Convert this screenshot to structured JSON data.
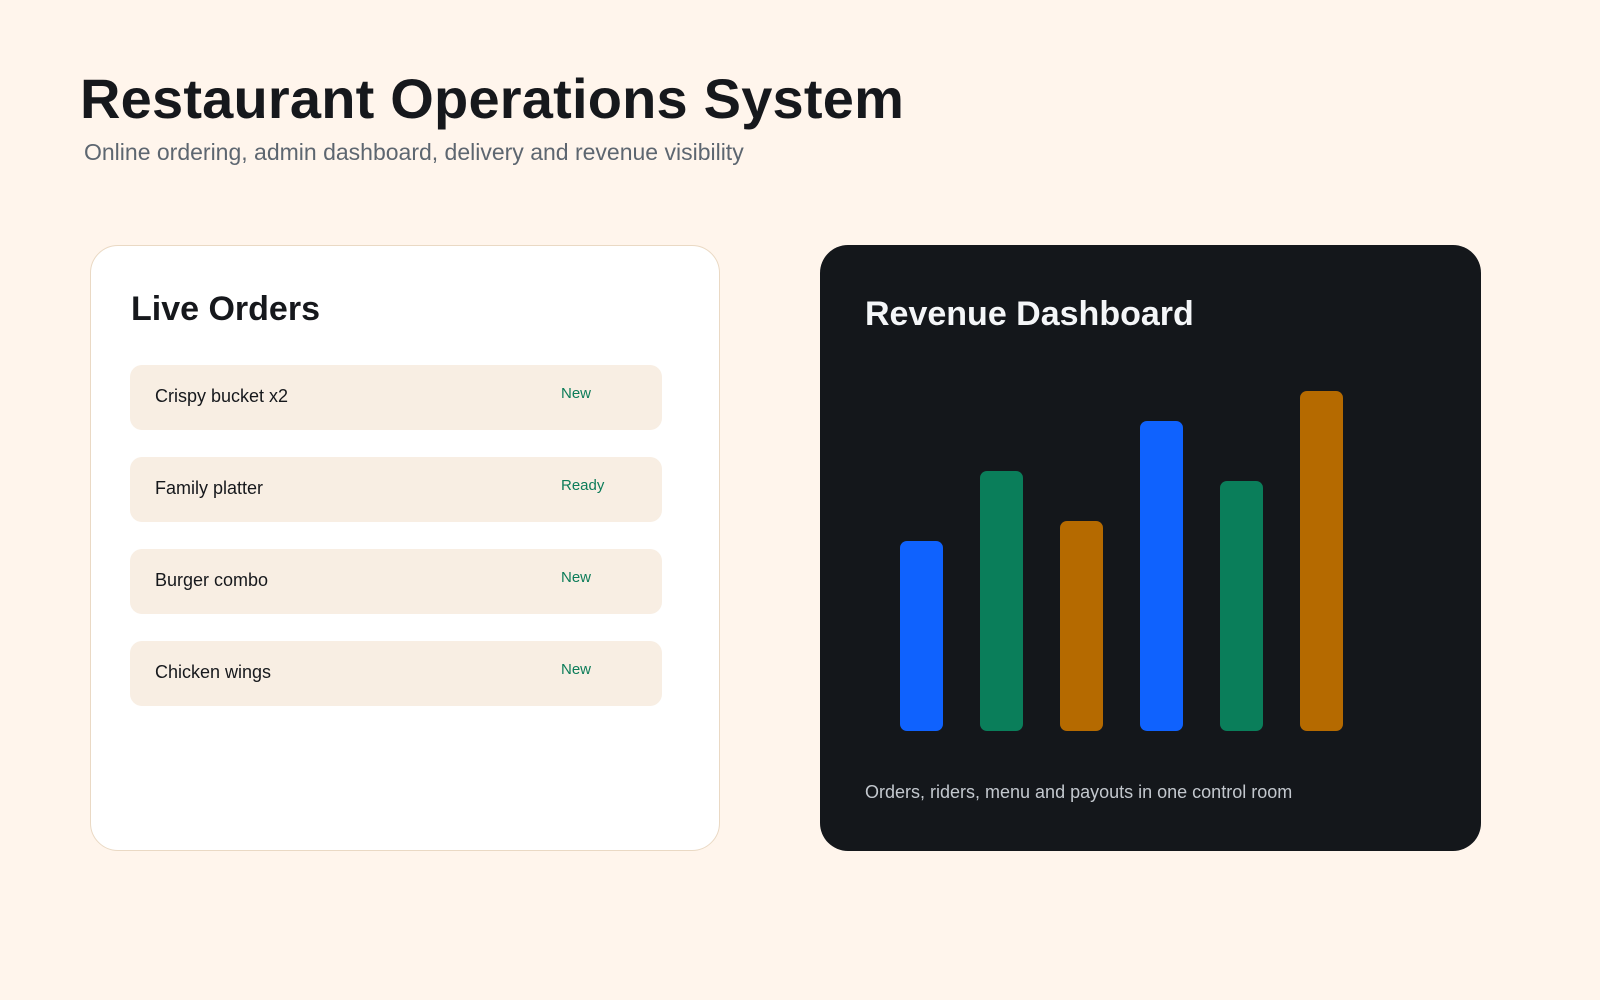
{
  "header": {
    "title": "Restaurant Operations System",
    "subtitle": "Online ordering, admin dashboard, delivery and revenue visibility"
  },
  "orders": {
    "title": "Live Orders",
    "items": [
      {
        "name": "Crispy bucket x2",
        "status": "New"
      },
      {
        "name": "Family platter",
        "status": "Ready"
      },
      {
        "name": "Burger combo",
        "status": "New"
      },
      {
        "name": "Chicken wings",
        "status": "New"
      }
    ]
  },
  "revenue": {
    "title": "Revenue Dashboard",
    "caption": "Orders, riders, menu and payouts in one control room"
  },
  "colors": {
    "page_background": "#fff5ec",
    "status_text": "#0c7c59",
    "dark_card": "#14171b"
  },
  "chart_data": {
    "type": "bar",
    "title": "",
    "xlabel": "",
    "ylabel": "",
    "categories": [
      "",
      "",
      "",
      "",
      "",
      ""
    ],
    "values": [
      190,
      260,
      210,
      310,
      250,
      340
    ],
    "colors": [
      "#0f62fe",
      "#0a7e5a",
      "#b56a00",
      "#0f62fe",
      "#0a7e5a",
      "#b56a00"
    ],
    "ylim": [
      0,
      340
    ],
    "grid": false,
    "legend": "none",
    "axes_visible": false
  }
}
